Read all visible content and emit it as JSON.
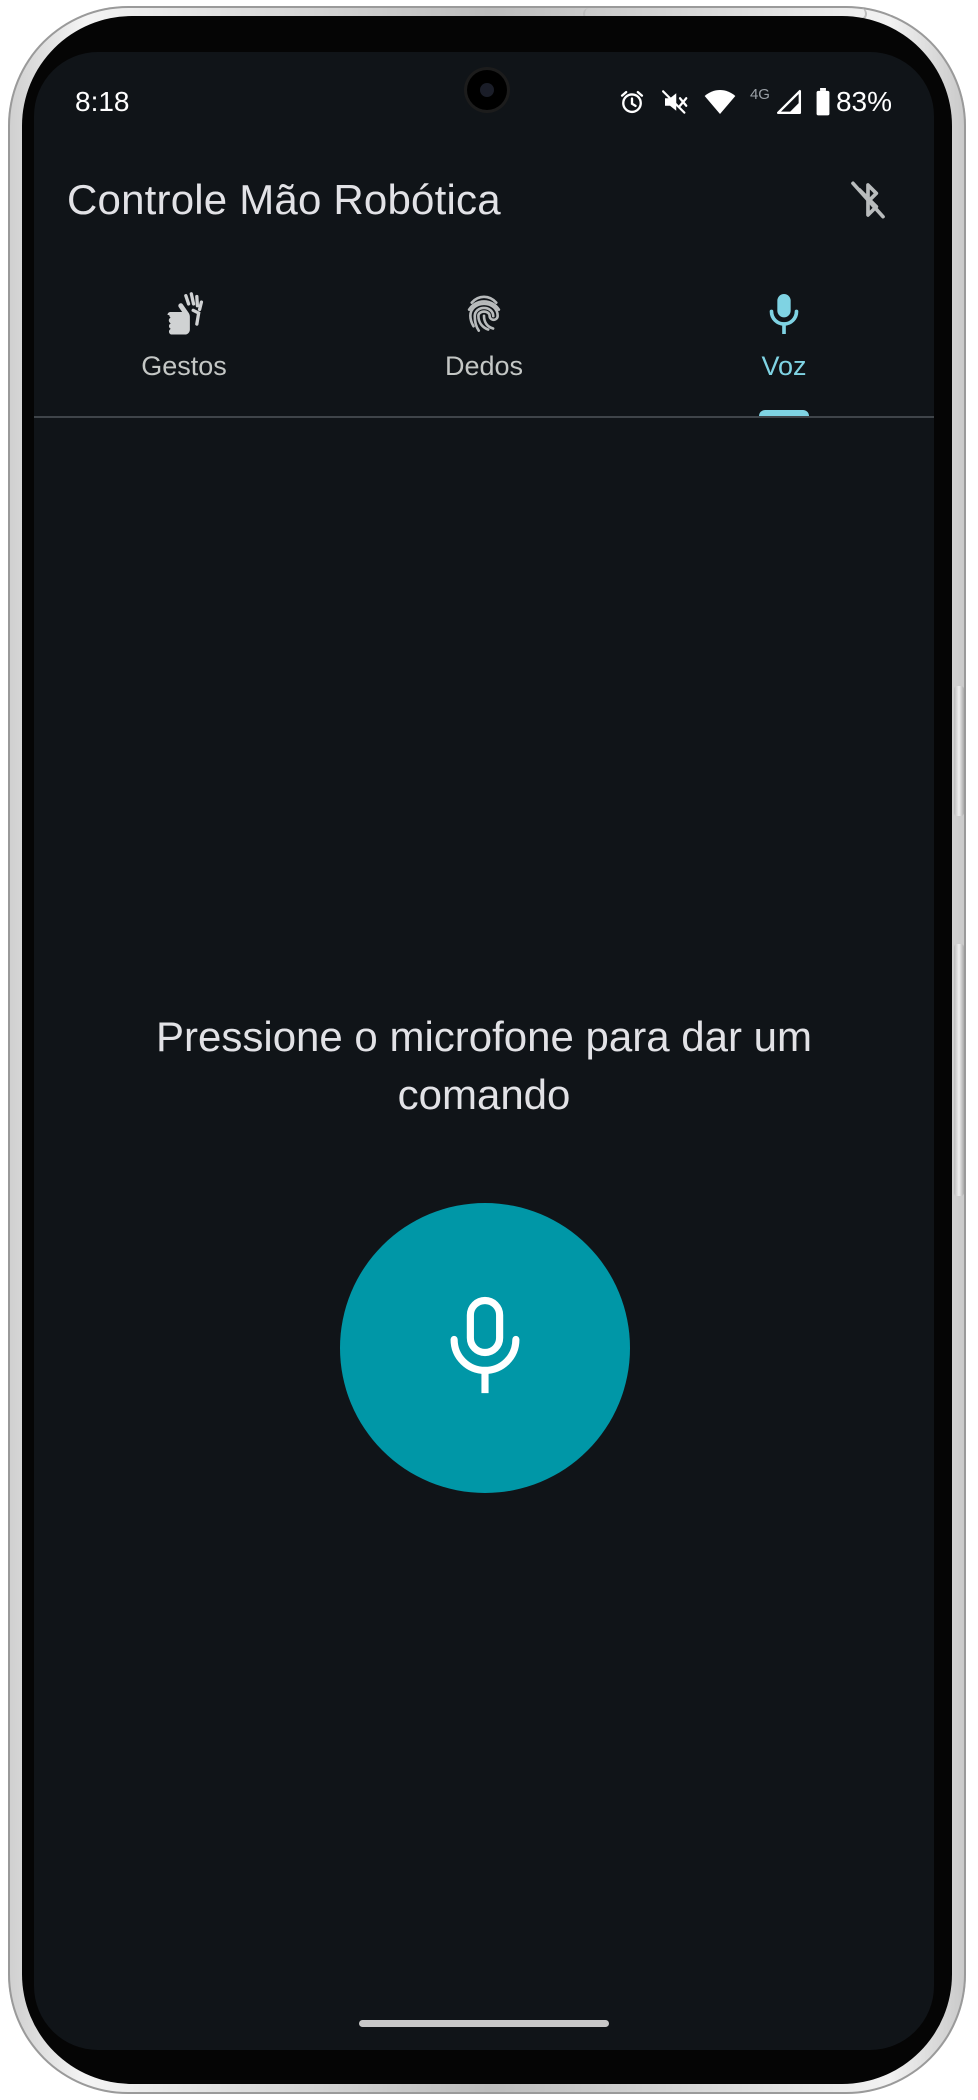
{
  "status_bar": {
    "time": "8:18",
    "network_type": "4G",
    "battery_percent": "83%",
    "icons": [
      "alarm-icon",
      "mute-icon",
      "wifi-icon",
      "signal-icon",
      "battery-icon"
    ]
  },
  "app_bar": {
    "title": "Controle Mão Robótica",
    "bluetooth_icon": "bluetooth-disabled-icon"
  },
  "tabs": [
    {
      "label": "Gestos",
      "icon": "sign-language-icon",
      "active": false
    },
    {
      "label": "Dedos",
      "icon": "fingerprint-icon",
      "active": false
    },
    {
      "label": "Voz",
      "icon": "mic-icon",
      "active": true
    }
  ],
  "voice": {
    "prompt": "Pressione o microfone para dar um comando",
    "button_icon": "mic-icon"
  },
  "colors": {
    "background": "#101418",
    "accent": "#7fd3e3",
    "fab": "#0097a7",
    "text": "#e2e2e6"
  }
}
